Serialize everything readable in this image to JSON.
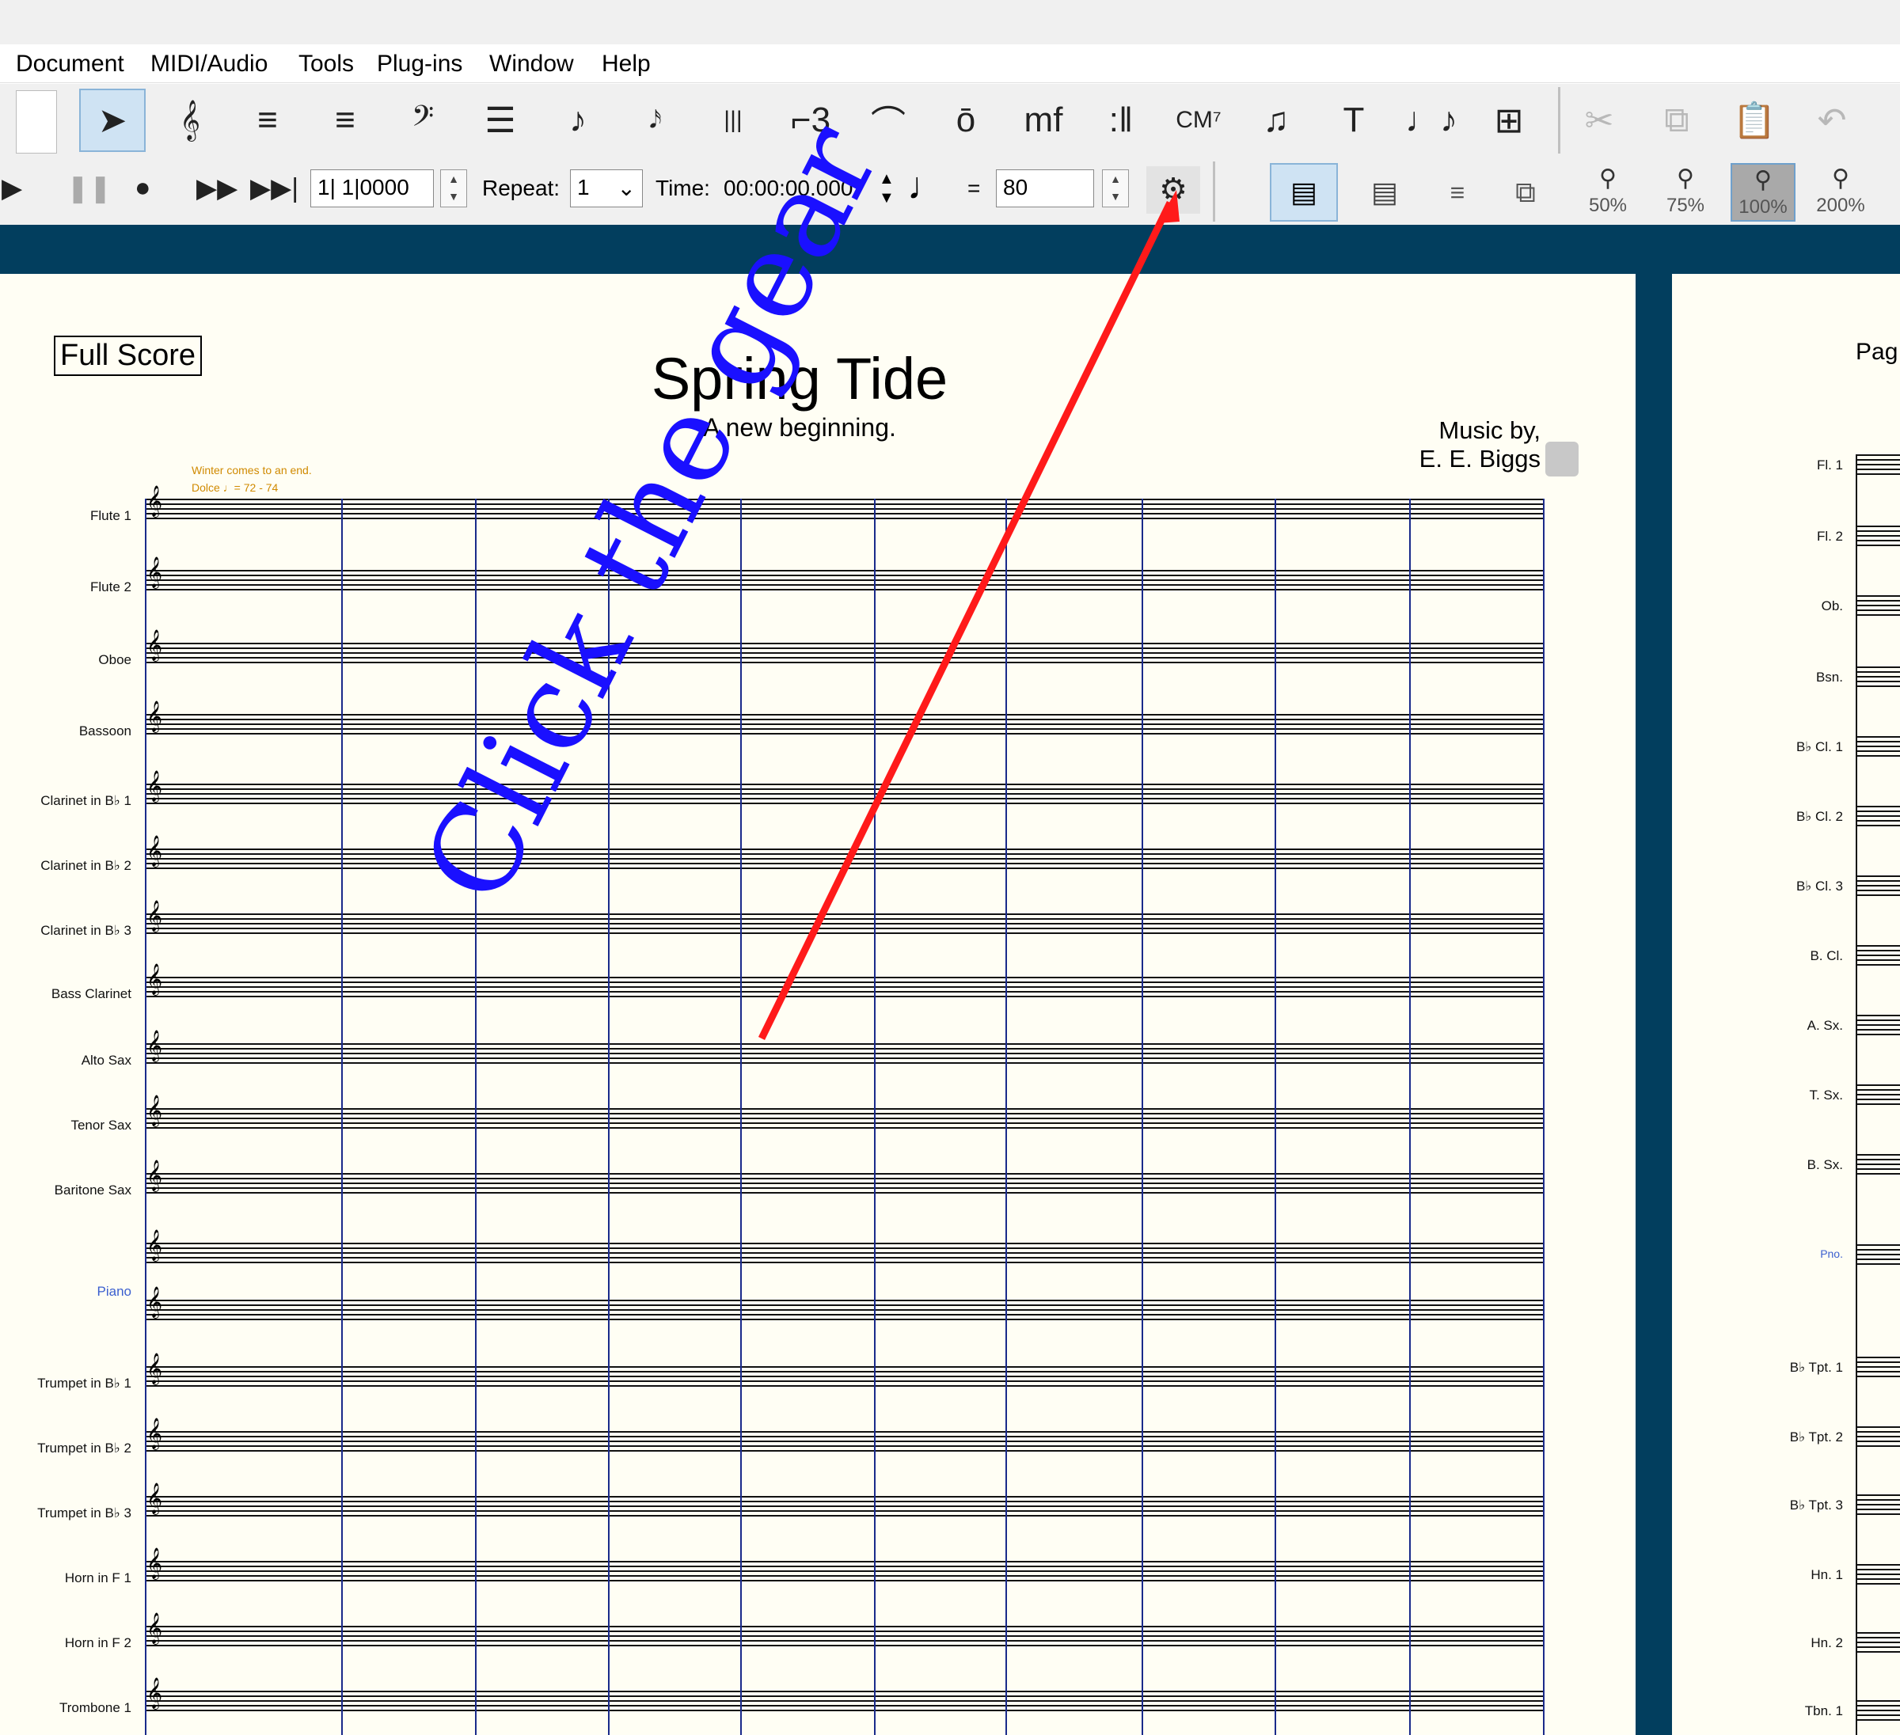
{
  "menubar": {
    "items": [
      "Document",
      "MIDI/Audio",
      "Tools",
      "Plug-ins",
      "Window",
      "Help"
    ]
  },
  "toolbar": {
    "tools": [
      {
        "name": "selection-tool",
        "glyph": "➤",
        "selected": true
      },
      {
        "name": "treble-clef-tool",
        "glyph": "𝄞"
      },
      {
        "name": "key-signature-tool",
        "glyph": "≡"
      },
      {
        "name": "time-signature-tool",
        "glyph": "≡"
      },
      {
        "name": "bass-clef-tool",
        "glyph": "𝄢"
      },
      {
        "name": "staff-tool",
        "glyph": "☰"
      },
      {
        "name": "note-tool",
        "glyph": "♪"
      },
      {
        "name": "grace-note-tool",
        "glyph": "𝅘𝅥𝅯"
      },
      {
        "name": "keyboard-tool",
        "glyph": "|||"
      },
      {
        "name": "tuplet-tool",
        "glyph": "⌐3"
      },
      {
        "name": "slur-tool",
        "glyph": "⌒"
      },
      {
        "name": "articulation-tool",
        "glyph": "ō"
      },
      {
        "name": "dynamics-tool",
        "glyph": "mf"
      },
      {
        "name": "repeat-tool",
        "glyph": ":‖"
      },
      {
        "name": "chord-tool",
        "glyph": "CM⁷"
      },
      {
        "name": "lyrics-tool",
        "glyph": "♫"
      },
      {
        "name": "text-tool",
        "glyph": "T"
      },
      {
        "name": "smart-shape-tool",
        "glyph": "♩♪"
      },
      {
        "name": "page-layout-tool",
        "glyph": "⊞"
      }
    ],
    "edit_tools": [
      {
        "name": "cut-icon",
        "glyph": "✂"
      },
      {
        "name": "copy-icon",
        "glyph": "⧉"
      },
      {
        "name": "paste-icon",
        "glyph": "📋"
      },
      {
        "name": "undo-icon",
        "glyph": "↶"
      }
    ]
  },
  "playback": {
    "position": "1| 1|0000",
    "repeat_label": "Repeat:",
    "repeat_value": "1",
    "time_label": "Time:",
    "time_value": "00:00:00.000",
    "equals": "=",
    "tempo_value": "80"
  },
  "zoom": {
    "levels": [
      "50%",
      "75%",
      "100%",
      "200%"
    ],
    "selected": "100%"
  },
  "score": {
    "part_label": "Full Score",
    "title": "Spring Tide",
    "subtitle": "A new beginning.",
    "composer_line1": "Music by,",
    "composer_line2": "E. E. Biggs",
    "tempo_text": "Winter comes to an end.",
    "tempo_marking": "Dolce ♩= 72 - 74",
    "instruments": [
      "Flute 1",
      "Flute 2",
      "Oboe",
      "Bassoon",
      "Clarinet in B♭ 1",
      "Clarinet in B♭ 2",
      "Clarinet in B♭ 3",
      "Bass Clarinet",
      "Alto Sax",
      "Tenor Sax",
      "Baritone Sax",
      "Piano",
      "Trumpet in B♭ 1",
      "Trumpet in B♭ 2",
      "Trumpet in B♭ 3",
      "Horn in F 1",
      "Horn in F 2",
      "Trombone 1"
    ]
  },
  "page2": {
    "header_partial": "Pag",
    "instruments": [
      "Fl. 1",
      "Fl. 2",
      "Ob.",
      "Bsn.",
      "B♭ Cl. 1",
      "B♭ Cl. 2",
      "B♭ Cl. 3",
      "B. Cl.",
      "A. Sx.",
      "T. Sx.",
      "B. Sx.",
      "Pno.",
      "B♭ Tpt. 1",
      "B♭ Tpt. 2",
      "B♭ Tpt. 3",
      "Hn. 1",
      "Hn. 2",
      "Tbn. 1"
    ]
  },
  "annotation": {
    "text": "Click the gear",
    "color": "#1a10ff",
    "arrow_color": "#ff1a1a"
  }
}
